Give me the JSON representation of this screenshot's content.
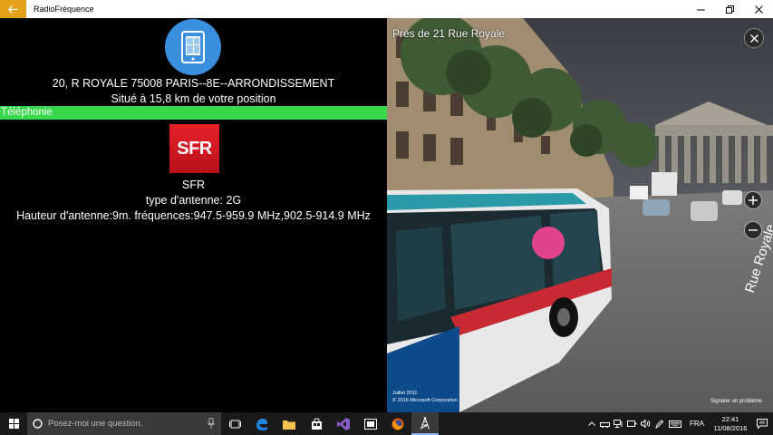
{
  "titlebar": {
    "app_title": "RadioFréquence"
  },
  "site": {
    "address": "20, R ROYALE 75008 PARIS--8E--ARRONDISSEMENT",
    "distance": "Situé à 15,8 km de votre position",
    "category": "Téléphonie",
    "operator_logo": "SFR",
    "operator_name": "SFR",
    "antenna_type": "type d'antenne: 2G",
    "antenna_details": "Hauteur d'antenne:9m. fréquences:947.5-959.9 MHz,902.5-914.9 MHz"
  },
  "streetview": {
    "location": "Près de 21 Rue Royale",
    "date": "Juillet 2011",
    "copyright": "© 2016 Microsoft Corporation",
    "report": "Signaler un problème",
    "street_label": "Rue Royale"
  },
  "taskbar": {
    "search_placeholder": "Posez-moi une question.",
    "language": "FRA",
    "time": "22:41",
    "date": "11/08/2016"
  },
  "colors": {
    "accent": "#e3a21a",
    "category_bar": "#38d84a",
    "operator_red": "#d4161f",
    "phone_icon_bg": "#3a8fde"
  }
}
